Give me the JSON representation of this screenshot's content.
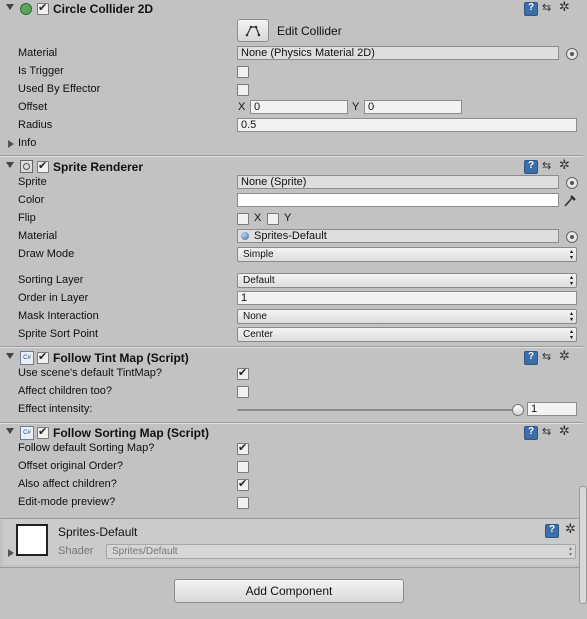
{
  "circle_collider": {
    "title": "Circle Collider 2D",
    "edit_collider": "Edit Collider",
    "material_label": "Material",
    "material_value": "None (Physics Material 2D)",
    "is_trigger_label": "Is Trigger",
    "used_by_effector_label": "Used By Effector",
    "offset_label": "Offset",
    "offset_x_label": "X",
    "offset_x": "0",
    "offset_y_label": "Y",
    "offset_y": "0",
    "radius_label": "Radius",
    "radius": "0.5",
    "info_label": "Info"
  },
  "sprite_renderer": {
    "title": "Sprite Renderer",
    "sprite_label": "Sprite",
    "sprite_value": "None (Sprite)",
    "color_label": "Color",
    "color_value": "#ffffff",
    "flip_label": "Flip",
    "flip_x": "X",
    "flip_y": "Y",
    "material_label": "Material",
    "material_value": "Sprites-Default",
    "draw_mode_label": "Draw Mode",
    "draw_mode_value": "Simple",
    "sorting_layer_label": "Sorting Layer",
    "sorting_layer_value": "Default",
    "order_label": "Order in Layer",
    "order_value": "1",
    "mask_label": "Mask Interaction",
    "mask_value": "None",
    "sort_point_label": "Sprite Sort Point",
    "sort_point_value": "Center"
  },
  "follow_tint": {
    "title": "Follow Tint Map (Script)",
    "use_default_label": "Use scene's default TintMap?",
    "use_default_checked": true,
    "affect_children_label": "Affect children too?",
    "affect_children_checked": false,
    "intensity_label": "Effect intensity:",
    "intensity_value": "1",
    "intensity_fraction": 1.0
  },
  "follow_sorting": {
    "title": "Follow Sorting Map (Script)",
    "follow_default_label": "Follow default Sorting Map?",
    "follow_default_checked": true,
    "offset_original_label": "Offset original Order?",
    "offset_original_checked": false,
    "also_affect_label": "Also affect children?",
    "also_affect_checked": true,
    "edit_preview_label": "Edit-mode preview?",
    "edit_preview_checked": false
  },
  "material_asset": {
    "name": "Sprites-Default",
    "shader_label": "Shader",
    "shader_value": "Sprites/Default"
  },
  "add_component_label": "Add Component",
  "icons": {
    "help": "help-book-icon",
    "presets": "presets-sliders-icon",
    "settings": "gear-icon",
    "object_picker": "object-picker-icon",
    "eyedropper": "eyedropper-icon",
    "script": "script-icon"
  }
}
